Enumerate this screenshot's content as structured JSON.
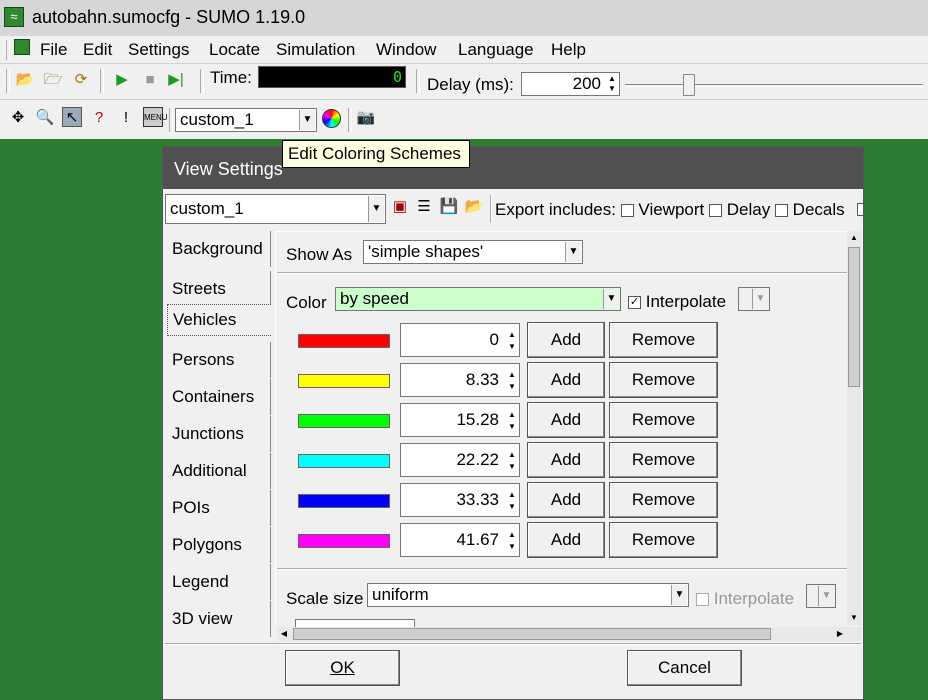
{
  "window": {
    "title": "autobahn.sumocfg - SUMO 1.19.0"
  },
  "menu": [
    "File",
    "Edit",
    "Settings",
    "Locate",
    "Simulation",
    "Window",
    "Language",
    "Help"
  ],
  "toolbar": {
    "time_label": "Time:",
    "time_value": "0",
    "delay_label": "Delay (ms):",
    "delay_value": "200",
    "scheme": "custom_1"
  },
  "tooltip": "Edit Coloring Schemes",
  "dialog": {
    "title": "View Settings",
    "scheme": "custom_1",
    "export_label": "Export includes:",
    "export_options": [
      "Viewport",
      "Delay",
      "Decals"
    ],
    "tabs": [
      "Background",
      "Streets",
      "Vehicles",
      "Persons",
      "Containers",
      "Junctions",
      "Additional",
      "POIs",
      "Polygons",
      "Legend",
      "3D view"
    ],
    "selected_tab": "Vehicles",
    "show_as_label": "Show As",
    "show_as": "'simple shapes'",
    "color_label": "Color",
    "color_value": "by speed",
    "interpolate": "Interpolate",
    "rows": [
      {
        "color": "#ff0000",
        "value": "0"
      },
      {
        "color": "#ffff00",
        "value": "8.33"
      },
      {
        "color": "#00ff00",
        "value": "15.28"
      },
      {
        "color": "#00ffff",
        "value": "22.22"
      },
      {
        "color": "#0000ff",
        "value": "33.33"
      },
      {
        "color": "#ff00ff",
        "value": "41.67"
      }
    ],
    "add": "Add",
    "remove": "Remove",
    "scale_label": "Scale size",
    "scale_value": "uniform",
    "scale_interpolate": "Interpolate",
    "ok": "OK",
    "cancel": "Cancel"
  },
  "colors": {
    "canvas": "#2e7d32",
    "dialog_title_bg": "#505050",
    "color_combo_bg": "#ccffcc",
    "time_digits": "#11ee11"
  }
}
